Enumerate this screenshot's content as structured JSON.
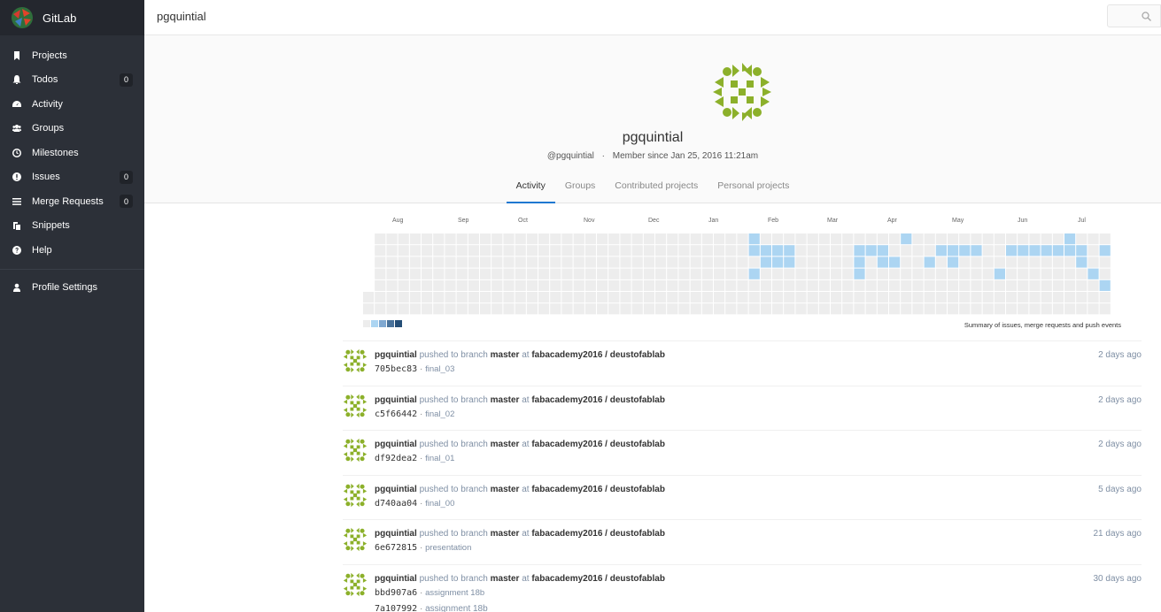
{
  "app": {
    "brand": "GitLab",
    "page_title": "pgquintial",
    "colors": {
      "sidebar": "#2c3038",
      "accent": "#1f78d1",
      "avatar": "#8cb02a",
      "contrib": "#acd5f2"
    }
  },
  "sidebar": {
    "items": [
      {
        "label": "Projects",
        "icon": "bookmark-icon"
      },
      {
        "label": "Todos",
        "icon": "bell-icon",
        "badge": "0"
      },
      {
        "label": "Activity",
        "icon": "dashboard-icon"
      },
      {
        "label": "Groups",
        "icon": "users-icon"
      },
      {
        "label": "Milestones",
        "icon": "clock-icon"
      },
      {
        "label": "Issues",
        "icon": "exclamation-circle-icon",
        "badge": "0"
      },
      {
        "label": "Merge Requests",
        "icon": "list-icon",
        "badge": "0"
      },
      {
        "label": "Snippets",
        "icon": "clipboard-icon"
      },
      {
        "label": "Help",
        "icon": "question-circle-icon"
      }
    ],
    "profile_settings": {
      "label": "Profile Settings",
      "icon": "user-icon"
    }
  },
  "profile": {
    "name": "pgquintial",
    "handle": "@pgquintial",
    "separator": "·",
    "member_since": "Member since Jan 25, 2016 11:21am",
    "tabs": [
      "Activity",
      "Groups",
      "Contributed projects",
      "Personal projects"
    ],
    "active_tab": "Activity"
  },
  "calendar": {
    "months": [
      "Aug",
      "Sep",
      "Oct",
      "Nov",
      "Dec",
      "Jan",
      "Feb",
      "Mar",
      "Apr",
      "May",
      "Jun",
      "Jul"
    ],
    "summary": "Summary of issues, merge requests and push events",
    "legend_colors": [
      "#ededed",
      "#acd5f2",
      "#7fa8d1",
      "#49729b",
      "#254e77"
    ]
  },
  "events": [
    {
      "user": "pgquintial",
      "action": "pushed to branch",
      "branch": "master",
      "at": "at",
      "project": "fabacademy2016 / deustofablab",
      "sha": "705bec83",
      "message": "final_03",
      "time": "2 days ago"
    },
    {
      "user": "pgquintial",
      "action": "pushed to branch",
      "branch": "master",
      "at": "at",
      "project": "fabacademy2016 / deustofablab",
      "sha": "c5f66442",
      "message": "final_02",
      "time": "2 days ago"
    },
    {
      "user": "pgquintial",
      "action": "pushed to branch",
      "branch": "master",
      "at": "at",
      "project": "fabacademy2016 / deustofablab",
      "sha": "df92dea2",
      "message": "final_01",
      "time": "2 days ago"
    },
    {
      "user": "pgquintial",
      "action": "pushed to branch",
      "branch": "master",
      "at": "at",
      "project": "fabacademy2016 / deustofablab",
      "sha": "d740aa04",
      "message": "final_00",
      "time": "5 days ago"
    },
    {
      "user": "pgquintial",
      "action": "pushed to branch",
      "branch": "master",
      "at": "at",
      "project": "fabacademy2016 / deustofablab",
      "sha": "6e672815",
      "message": "presentation",
      "time": "21 days ago"
    },
    {
      "user": "pgquintial",
      "action": "pushed to branch",
      "branch": "master",
      "at": "at",
      "project": "fabacademy2016 / deustofablab",
      "sha": "bbd907a6",
      "message": "assignment 18b",
      "time": "30 days ago"
    }
  ],
  "cut_event": {
    "sha": "7a107992",
    "message": "assignment 18b"
  }
}
